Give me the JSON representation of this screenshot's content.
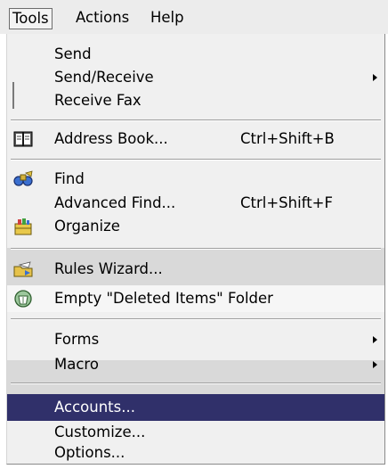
{
  "menubar": {
    "tools": "Tools",
    "actions": "Actions",
    "help": "Help"
  },
  "menu": {
    "send": "Send",
    "send_receive": "Send/Receive",
    "receive_fax": "Receive Fax",
    "address_book": "Address Book...",
    "address_book_shortcut": "Ctrl+Shift+B",
    "find": "Find",
    "advanced_find": "Advanced Find...",
    "advanced_find_shortcut": "Ctrl+Shift+F",
    "organize": "Organize",
    "rules_wizard": "Rules Wizard...",
    "empty_deleted": "Empty \"Deleted Items\" Folder",
    "forms": "Forms",
    "macro": "Macro",
    "accounts": "Accounts...",
    "customize": "Customize...",
    "options": "Options..."
  },
  "colors": {
    "highlight": "#30306a",
    "menu_bg": "#f0f0f0"
  }
}
